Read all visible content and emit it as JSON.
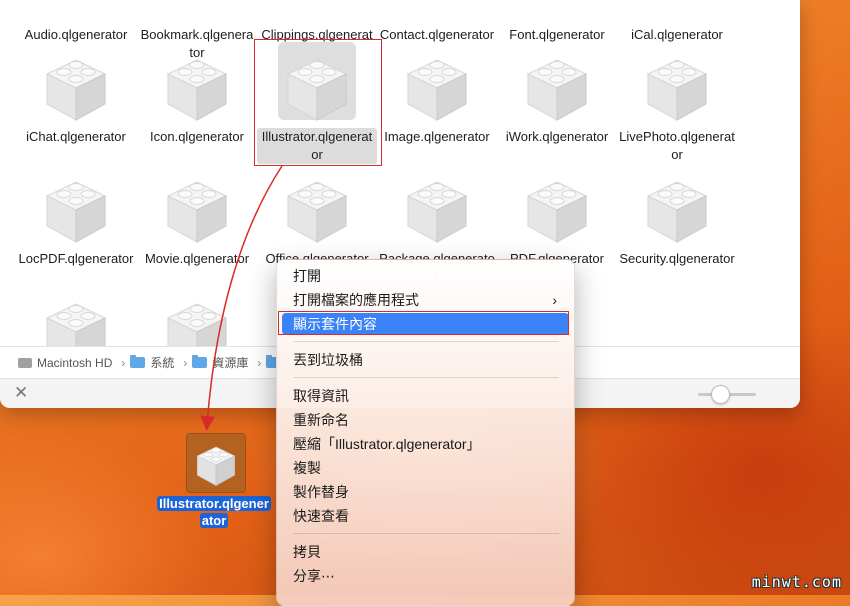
{
  "files": [
    {
      "name": "Audio.qlgenerator",
      "row": 0,
      "col": 0,
      "show_icon": false
    },
    {
      "name": "Bookmark.qlgenerator",
      "row": 0,
      "col": 1,
      "show_icon": false
    },
    {
      "name": "Clippings.qlgenerator",
      "row": 0,
      "col": 2,
      "show_icon": false
    },
    {
      "name": "Contact.qlgenerator",
      "row": 0,
      "col": 3,
      "show_icon": false
    },
    {
      "name": "Font.qlgenerator",
      "row": 0,
      "col": 4,
      "show_icon": false
    },
    {
      "name": "iCal.qlgenerator",
      "row": 0,
      "col": 5,
      "show_icon": false
    },
    {
      "name": "iChat.qlgenerator",
      "row": 1,
      "col": 0,
      "show_icon": true
    },
    {
      "name": "Icon.qlgenerator",
      "row": 1,
      "col": 1,
      "show_icon": true
    },
    {
      "name": "Illustrator.qlgenerator",
      "row": 1,
      "col": 2,
      "show_icon": true,
      "selected": true
    },
    {
      "name": "Image.qlgenerator",
      "row": 1,
      "col": 3,
      "show_icon": true
    },
    {
      "name": "iWork.qlgenerator",
      "row": 1,
      "col": 4,
      "show_icon": true
    },
    {
      "name": "LivePhoto.qlgenerator",
      "row": 1,
      "col": 5,
      "show_icon": true
    },
    {
      "name": "LocPDF.qlgenerator",
      "row": 2,
      "col": 0,
      "show_icon": true
    },
    {
      "name": "Movie.qlgenerator",
      "row": 2,
      "col": 1,
      "show_icon": true
    },
    {
      "name": "Office.qlgenerator",
      "row": 2,
      "col": 2,
      "show_icon": true
    },
    {
      "name": "Package.qlgenerator",
      "row": 2,
      "col": 3,
      "show_icon": true
    },
    {
      "name": "PDF.qlgenerator",
      "row": 2,
      "col": 4,
      "show_icon": true
    },
    {
      "name": "Security.qlgenerator",
      "row": 2,
      "col": 5,
      "show_icon": true
    },
    {
      "name": "",
      "row": 3,
      "col": 0,
      "show_icon": true
    },
    {
      "name": "",
      "row": 3,
      "col": 1,
      "show_icon": true
    }
  ],
  "pathbar": {
    "disk": "Macintosh HD",
    "folder1": "系統",
    "folder2": "資源庫"
  },
  "desktop_icon": {
    "label_line1": "Illustrator.qlgener",
    "label_line2": "ator"
  },
  "context_menu": {
    "items": [
      {
        "label": "打開"
      },
      {
        "label": "打開檔案的應用程式",
        "submenu": true
      },
      {
        "label": "顯示套件內容",
        "active": true
      },
      {
        "label": "丟到垃圾桶"
      },
      {
        "label": "取得資訊"
      },
      {
        "label": "重新命名"
      },
      {
        "label": "壓縮「Illustrator.qlgenerator」"
      },
      {
        "label": "複製"
      },
      {
        "label": "製作替身"
      },
      {
        "label": "快速查看"
      },
      {
        "label": "拷貝"
      },
      {
        "label": "分享⋯"
      }
    ],
    "submenu_arrow": "›"
  },
  "watermark": "minwt.com",
  "colors": {
    "highlight_red": "#d92a2a",
    "menu_active_blue": "#3b82f6",
    "desktop_selection_blue": "#1c64d8"
  }
}
